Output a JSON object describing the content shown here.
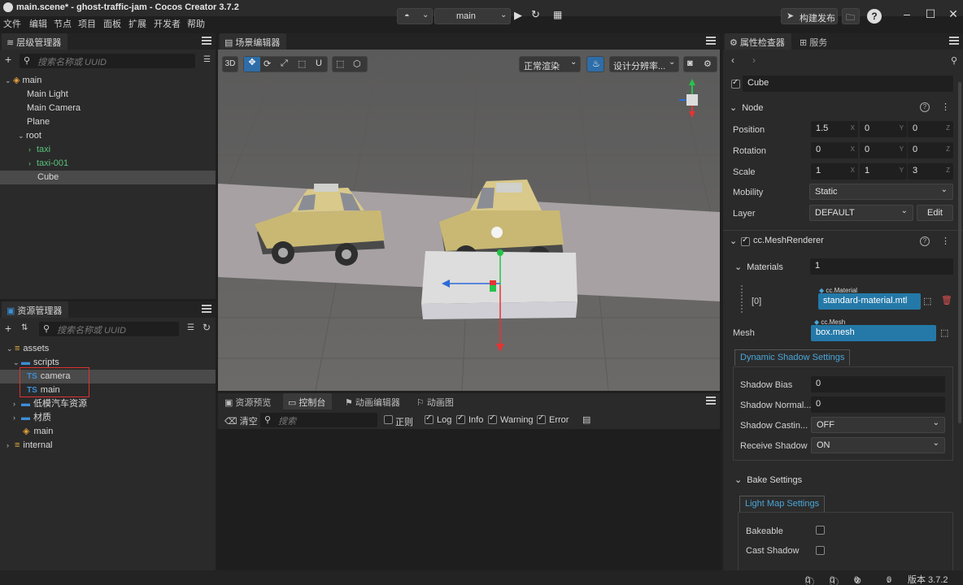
{
  "window": {
    "title": "main.scene* - ghost-traffic-jam - Cocos Creator 3.7.2",
    "menu": [
      "文件",
      "编辑",
      "节点",
      "项目",
      "面板",
      "扩展",
      "开发者",
      "帮助"
    ]
  },
  "toolbar": {
    "scene_name": "main",
    "publish_label": "构建发布"
  },
  "hierarchy": {
    "tab": "层级管理器",
    "search_placeholder": "搜索名称或 UUID",
    "items": [
      "main",
      "Main Light",
      "Main Camera",
      "Plane",
      "root",
      "taxi",
      "taxi-001",
      "Cube"
    ]
  },
  "assets": {
    "tab": "资源管理器",
    "search_placeholder": "搜索名称或 UUID",
    "items": [
      "assets",
      "scripts",
      "camera",
      "main",
      "低模汽车资源",
      "材质",
      "main",
      "internal"
    ],
    "ts_badge": "TS"
  },
  "scene": {
    "tab": "场景编辑器",
    "btn_3d": "3D",
    "render_mode": "正常渲染",
    "resolution": "设计分辨率..."
  },
  "console": {
    "tabs": [
      "资源预览",
      "控制台",
      "动画编辑器",
      "动画图"
    ],
    "clear": "清空",
    "search_placeholder": "搜索",
    "filters": [
      "正则",
      "Log",
      "Info",
      "Warning",
      "Error"
    ]
  },
  "inspector": {
    "tabs": [
      "属性检查器",
      "服务"
    ],
    "node_name": "Cube",
    "node_section": "Node",
    "position": {
      "label": "Position",
      "x": "1.5",
      "y": "0",
      "z": "0"
    },
    "rotation": {
      "label": "Rotation",
      "x": "0",
      "y": "0",
      "z": "0"
    },
    "scale": {
      "label": "Scale",
      "x": "1",
      "y": "1",
      "z": "3"
    },
    "axes": [
      "X",
      "Y",
      "Z"
    ],
    "mobility": {
      "label": "Mobility",
      "value": "Static"
    },
    "layer": {
      "label": "Layer",
      "value": "DEFAULT",
      "edit": "Edit"
    },
    "mesh_renderer": "cc.MeshRenderer",
    "materials": {
      "label": "Materials",
      "count": "1",
      "index": "[0]",
      "type": "cc.Material",
      "value": "standard-material.mtl"
    },
    "mesh": {
      "label": "Mesh",
      "type": "cc.Mesh",
      "value": "box.mesh"
    },
    "dynamic_shadow": {
      "tab": "Dynamic Shadow Settings",
      "shadow_bias": {
        "label": "Shadow Bias",
        "value": "0"
      },
      "shadow_normal": {
        "label": "Shadow Normal...",
        "value": "0"
      },
      "shadow_casting": {
        "label": "Shadow Castin...",
        "value": "OFF"
      },
      "receive_shadow": {
        "label": "Receive Shadow",
        "value": "ON"
      }
    },
    "bake": {
      "section": "Bake Settings",
      "tab": "Light Map Settings",
      "bakeable": "Bakeable",
      "cast_shadow": "Cast Shadow"
    }
  },
  "status": {
    "info_count": "0",
    "warning_count": "0",
    "error_count": "0",
    "notify_count": "0",
    "version": "版本 3.7.2"
  },
  "colors": {
    "accent_blue": "#2d7bbf",
    "selection_highlight": "#e03131"
  }
}
